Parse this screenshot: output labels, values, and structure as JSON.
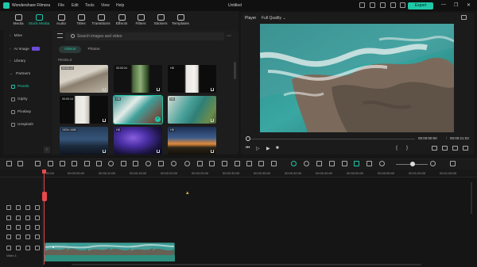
{
  "titlebar": {
    "app_name": "Wondershare Filmora",
    "menus": [
      "File",
      "Edit",
      "Tools",
      "View",
      "Help"
    ],
    "doc_title": "Untitled",
    "export_label": "Export",
    "window_controls": [
      "—",
      "❐",
      "✕"
    ]
  },
  "toolbar": {
    "tools": [
      {
        "label": "Media",
        "icon": "media-icon"
      },
      {
        "label": "Stock Media",
        "icon": "stock-media-icon",
        "active": true
      },
      {
        "label": "Audio",
        "icon": "audio-icon"
      },
      {
        "label": "Titles",
        "icon": "titles-icon"
      },
      {
        "label": "Transitions",
        "icon": "transitions-icon"
      },
      {
        "label": "Effects",
        "icon": "effects-icon"
      },
      {
        "label": "Filters",
        "icon": "filters-icon"
      },
      {
        "label": "Stickers",
        "icon": "stickers-icon"
      },
      {
        "label": "Templates",
        "icon": "templates-icon"
      }
    ]
  },
  "sidebar": {
    "items": [
      {
        "label": "Mine"
      },
      {
        "label": "AI Image"
      },
      {
        "label": "Library"
      },
      {
        "label": "Partners"
      }
    ],
    "partners": [
      {
        "label": "Pexels",
        "active": true
      },
      {
        "label": "Giphy"
      },
      {
        "label": "Pixabay"
      },
      {
        "label": "Unsplash"
      }
    ],
    "collapse_glyph": "‹"
  },
  "library": {
    "search_placeholder": "Search images and video",
    "segments": {
      "videos": "Videos",
      "photos": "Photos"
    },
    "source_label": "PEXELS",
    "thumbnails": [
      {
        "duration": "00:00:12"
      },
      {
        "duration": "00:00:24"
      },
      {
        "duration": "HD"
      },
      {
        "duration": "00:00:14"
      },
      {
        "duration": "HD",
        "selected": true
      },
      {
        "duration": "HD"
      },
      {
        "duration": "1920×1080"
      },
      {
        "duration": "HD"
      },
      {
        "duration": "HD"
      }
    ]
  },
  "player": {
    "label": "Player",
    "quality": "Full Quality",
    "time_current": "00:00:00:00",
    "time_sep": "/",
    "time_total": "00:00:21:03",
    "controls": {
      "prev": "⏮",
      "play": "▷",
      "next": "▶",
      "stop": "■",
      "mark_in": "{",
      "mark_out": "}"
    }
  },
  "ruler": {
    "ticks": [
      "00:00",
      "00:00:05:00",
      "00:00:10:00",
      "00:00:15:00",
      "00:00:20:00",
      "00:00:25:00",
      "00:00:30:00",
      "00:00:35:00",
      "00:00:40:00",
      "00:00:45:00",
      "00:00:50:00",
      "00:00:55:00",
      "00:01:00:00",
      "00:01:05:00"
    ]
  },
  "timeline": {
    "clip_name": "■",
    "track_label": "Video 1",
    "cursor_glyph": "▴"
  },
  "colors": {
    "accent": "#1fc8a8",
    "playhead": "#e8484e",
    "clip": "#2f8e7d",
    "background": "#161616"
  }
}
